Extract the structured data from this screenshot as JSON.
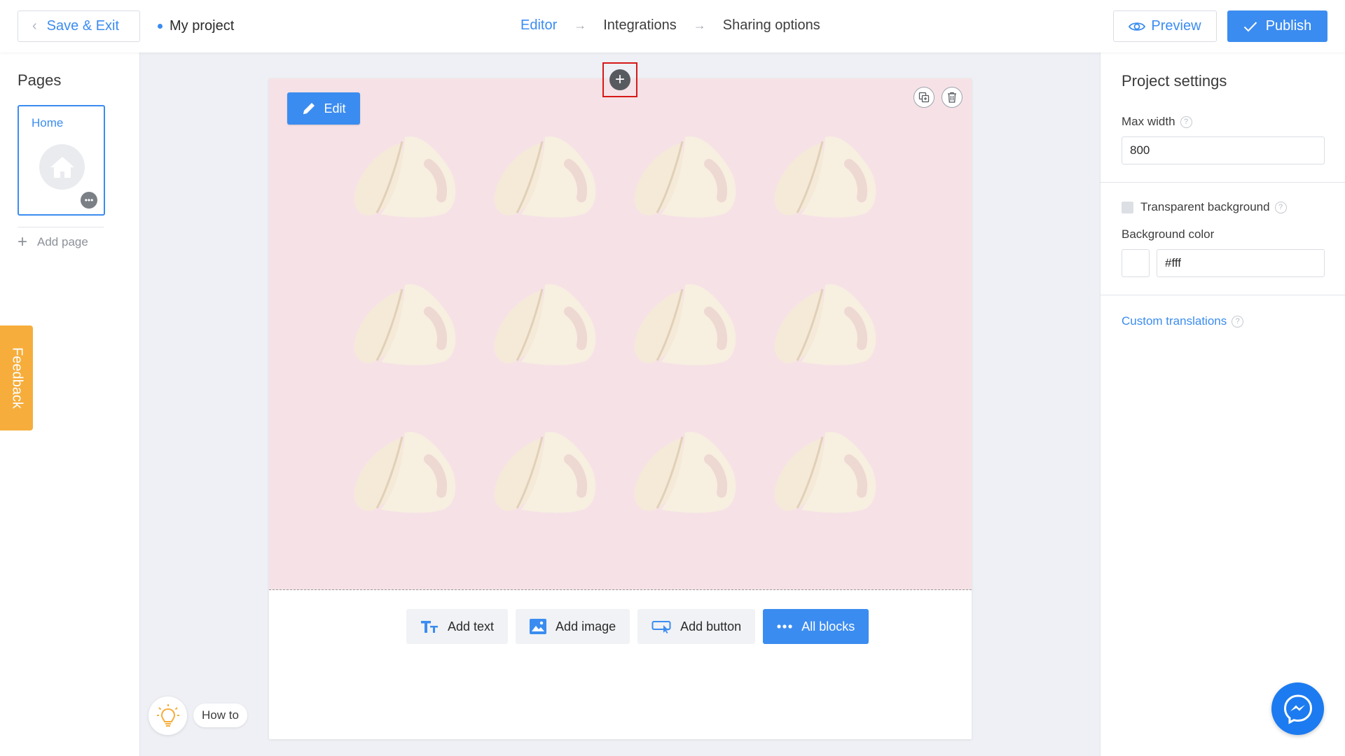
{
  "header": {
    "save_exit_label": "Save & Exit",
    "project_name": "My project",
    "steps": [
      {
        "label": "Editor",
        "active": true
      },
      {
        "label": "Integrations",
        "active": false
      },
      {
        "label": "Sharing options",
        "active": false
      }
    ],
    "preview_label": "Preview",
    "publish_label": "Publish"
  },
  "sidebar": {
    "title": "Pages",
    "pages": [
      {
        "label": "Home",
        "selected": true
      }
    ],
    "add_page_label": "Add page",
    "feedback_label": "Feedback"
  },
  "canvas": {
    "edit_label": "Edit",
    "cover_bg": "#f6e2e6",
    "block_bar": {
      "add_text": "Add text",
      "add_image": "Add image",
      "add_button": "Add button",
      "all_blocks": "All blocks"
    }
  },
  "settings": {
    "title": "Project settings",
    "max_width_label": "Max width",
    "max_width_value": "800",
    "transparent_bg_label": "Transparent background",
    "transparent_bg_checked": false,
    "bg_color_label": "Background color",
    "bg_color_value": "#fff",
    "custom_translations_label": "Custom translations"
  },
  "widgets": {
    "how_to_label": "How to"
  },
  "colors": {
    "accent": "#3b8cf0",
    "feedback": "#f6ad3b",
    "messenger": "#1c7bf0",
    "highlight": "#d71919"
  }
}
